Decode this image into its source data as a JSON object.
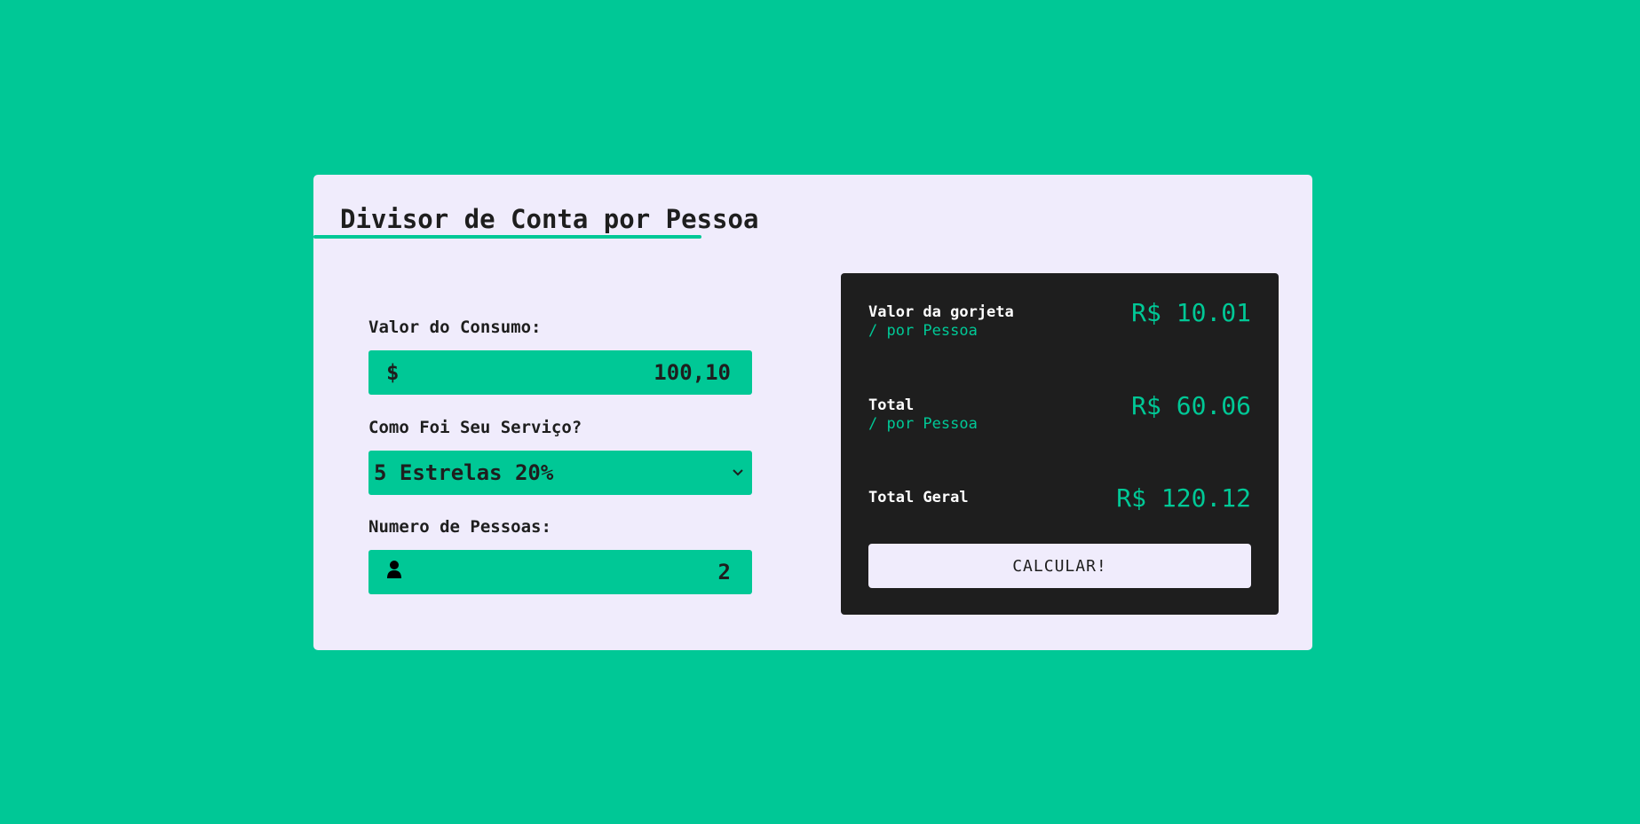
{
  "app": {
    "title": "Divisor de Conta por Pessoa"
  },
  "form": {
    "bill": {
      "label": "Valor do Consumo:",
      "prefix": "$",
      "value": "100,10"
    },
    "service": {
      "label": "Como Foi Seu Serviço?",
      "selected": "5 Estrelas 20%"
    },
    "people": {
      "label": "Numero de Pessoas:",
      "value": "2",
      "icon": "user-icon"
    }
  },
  "results": {
    "tip": {
      "label": "Valor da gorjeta",
      "sub": "/ por Pessoa",
      "value": "R$ 10.01"
    },
    "total": {
      "label": "Total",
      "sub": "/ por Pessoa",
      "value": "R$ 60.06"
    },
    "grand_total": {
      "label": "Total Geral",
      "value": "R$ 120.12"
    },
    "button_label": "CALCULAR!"
  },
  "colors": {
    "accent": "#00c896",
    "card": "#f0ecfc",
    "panel": "#1e1e1e"
  }
}
